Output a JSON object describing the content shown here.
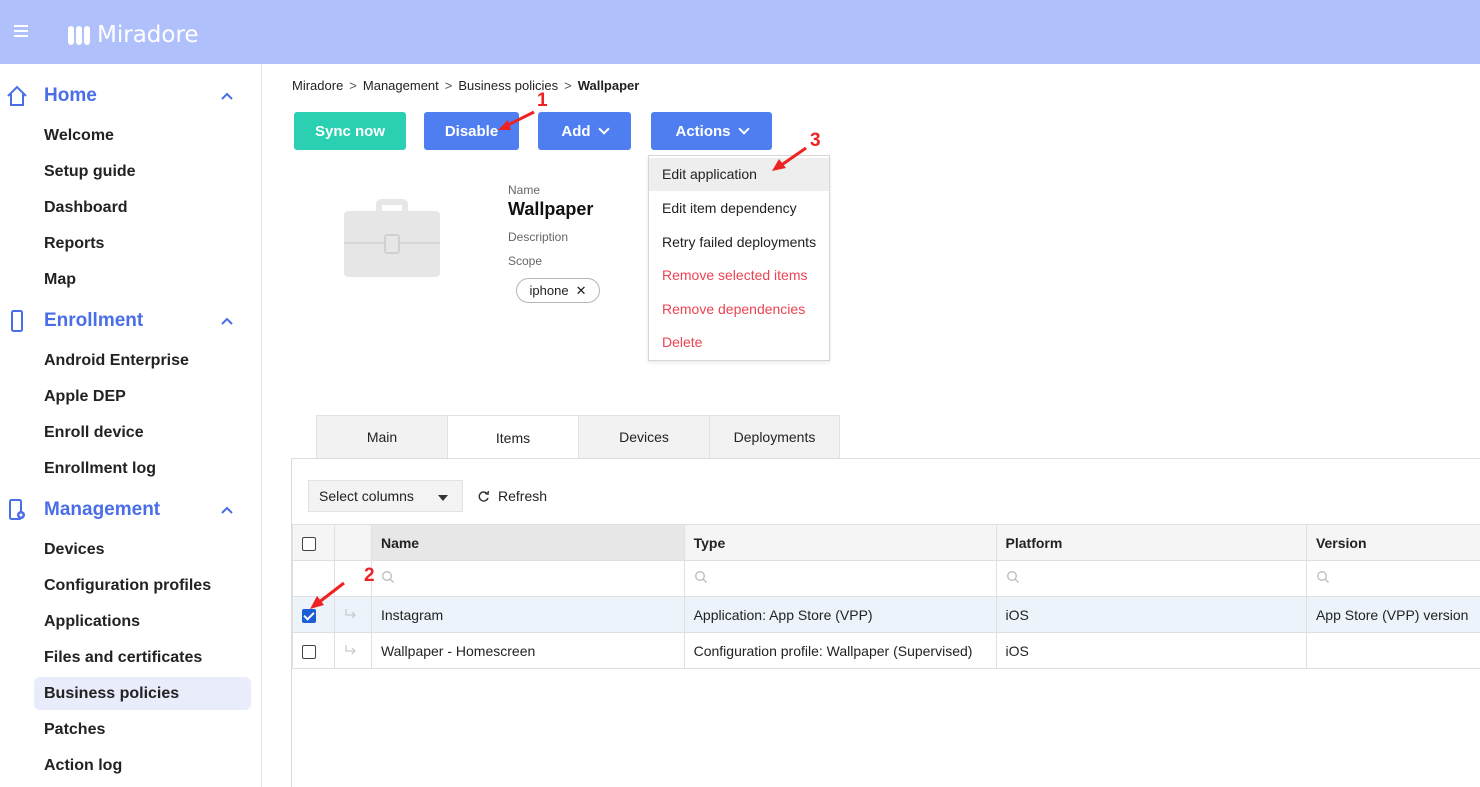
{
  "app": {
    "name": "Miradore"
  },
  "colors": {
    "topbar": "#b0c0fa",
    "accent": "#4e7ef0",
    "green": "#2bcfb1",
    "danger": "#ec4352"
  },
  "sidebar": {
    "sections": [
      {
        "label": "Home",
        "icon": "home-icon",
        "items": [
          "Welcome",
          "Setup guide",
          "Dashboard",
          "Reports",
          "Map"
        ]
      },
      {
        "label": "Enrollment",
        "icon": "phone-icon",
        "items": [
          "Android Enterprise",
          "Apple DEP",
          "Enroll device",
          "Enrollment log"
        ]
      },
      {
        "label": "Management",
        "icon": "management-icon",
        "items": [
          "Devices",
          "Configuration profiles",
          "Applications",
          "Files and certificates",
          "Business policies",
          "Patches",
          "Action log"
        ]
      }
    ],
    "active": "Business policies"
  },
  "breadcrumb": {
    "items": [
      "Miradore",
      "Management",
      "Business policies"
    ],
    "current": "Wallpaper",
    "separator": ">"
  },
  "toolbar": {
    "sync": "Sync now",
    "disable": "Disable",
    "add": "Add",
    "actions": "Actions"
  },
  "actions_menu": {
    "items": [
      {
        "label": "Edit application",
        "danger": false
      },
      {
        "label": "Edit item dependency",
        "danger": false
      },
      {
        "label": "Retry failed deployments",
        "danger": false
      },
      {
        "label": "Remove selected items",
        "danger": true
      },
      {
        "label": "Remove dependencies",
        "danger": true
      },
      {
        "label": "Delete",
        "danger": true
      }
    ]
  },
  "policy": {
    "name_label": "Name",
    "name": "Wallpaper",
    "description_label": "Description",
    "scope_label": "Scope",
    "scope_tag": "iphone"
  },
  "tabs": [
    "Main",
    "Items",
    "Devices",
    "Deployments"
  ],
  "active_tab": "Items",
  "table": {
    "select_columns": "Select columns",
    "refresh": "Refresh",
    "columns": [
      "Name",
      "Type",
      "Platform",
      "Version"
    ],
    "rows": [
      {
        "name": "Instagram",
        "type": "Application: App Store (VPP)",
        "platform": "iOS",
        "version": "App Store (VPP) version",
        "checked": true
      },
      {
        "name": "Wallpaper - Homescreen",
        "type": "Configuration profile: Wallpaper (Supervised)",
        "platform": "iOS",
        "version": "",
        "checked": false
      }
    ]
  },
  "annotations": [
    "1",
    "2",
    "3"
  ]
}
